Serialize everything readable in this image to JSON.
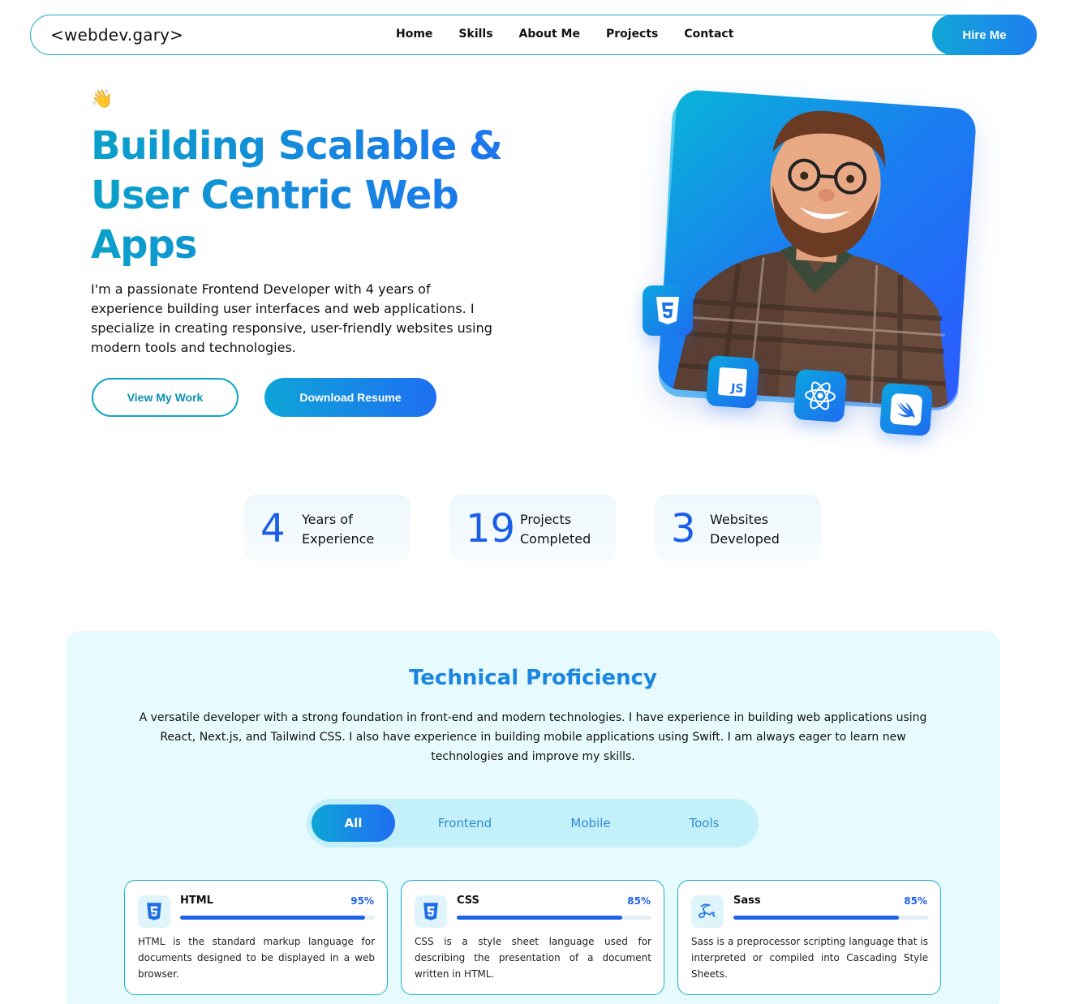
{
  "nav": {
    "logo": "<webdev.gary>",
    "links": [
      "Home",
      "Skills",
      "About Me",
      "Projects",
      "Contact"
    ],
    "hire_label": "Hire Me"
  },
  "hero": {
    "wave": "👋",
    "title": "Building Scalable & User Centric Web Apps",
    "description": "I'm a passionate Frontend Developer with 4 years of experience building user interfaces and web applications. I specialize in creating responsive, user-friendly websites using modern tools and technologies.",
    "view_work_label": "View My Work",
    "download_label": "Download Resume",
    "badges": [
      {
        "icon": "html5-icon",
        "text": "5"
      },
      {
        "icon": "javascript-icon",
        "text": "JS"
      },
      {
        "icon": "react-icon",
        "text": ""
      },
      {
        "icon": "swift-icon",
        "text": ""
      }
    ]
  },
  "stats": [
    {
      "number": "4",
      "label": "Years of Experience"
    },
    {
      "number": "19",
      "label": "Projects Completed"
    },
    {
      "number": "3",
      "label": "Websites Developed"
    }
  ],
  "skills": {
    "title": "Technical Proficiency",
    "description": "A versatile developer with a strong foundation in front-end and modern technologies. I have experience in building web applications using React, Next.js, and Tailwind CSS. I also have experience in building mobile applications using Swift. I am always eager to learn new technologies and improve my skills.",
    "tabs": [
      "All",
      "Frontend",
      "Mobile",
      "Tools"
    ],
    "active_tab": "All",
    "cards": [
      {
        "name": "HTML",
        "percent_label": "95%",
        "percent": 95,
        "icon": "html5-icon",
        "text": "HTML is the standard markup language for documents designed to be displayed in a web browser."
      },
      {
        "name": "CSS",
        "percent_label": "85%",
        "percent": 85,
        "icon": "css3-icon",
        "text": "CSS is a style sheet language used for describing the presentation of a document written in HTML."
      },
      {
        "name": "Sass",
        "percent_label": "85%",
        "percent": 85,
        "icon": "sass-icon",
        "text": "Sass is a preprocessor scripting language that is interpreted or compiled into Cascading Style Sheets."
      }
    ]
  },
  "colors": {
    "accent_start": "#0ea5d8",
    "accent_end": "#1f6ef2",
    "section_bg": "#e7fafd",
    "bar": "#1f63e8"
  }
}
